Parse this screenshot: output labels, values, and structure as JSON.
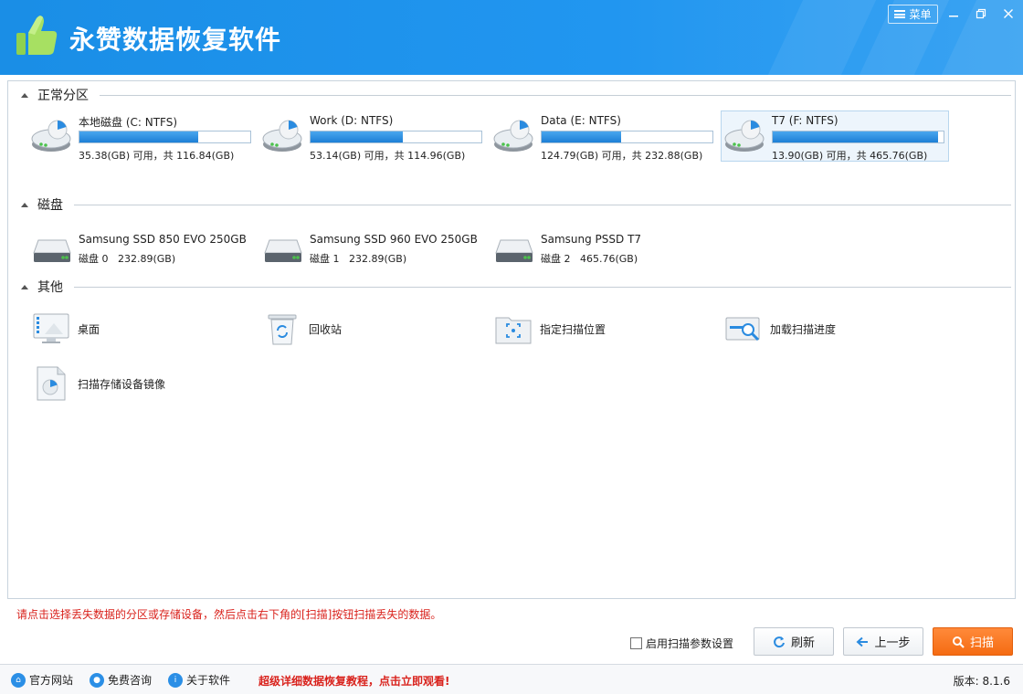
{
  "app": {
    "title": "永赞数据恢复软件",
    "menu_label": "菜单"
  },
  "sections": {
    "partitions": "正常分区",
    "disks": "磁盘",
    "other": "其他"
  },
  "partitions": [
    {
      "name": "本地磁盘 (C: NTFS)",
      "info": "35.38(GB) 可用，共 116.84(GB)",
      "used_fraction": 0.697,
      "selected": false
    },
    {
      "name": "Work (D: NTFS)",
      "info": "53.14(GB) 可用，共 114.96(GB)",
      "used_fraction": 0.538,
      "selected": false
    },
    {
      "name": "Data (E: NTFS)",
      "info": "124.79(GB) 可用，共 232.88(GB)",
      "used_fraction": 0.464,
      "selected": false
    },
    {
      "name": "T7 (F: NTFS)",
      "info": "13.90(GB) 可用，共 465.76(GB)",
      "used_fraction": 0.97,
      "selected": true
    }
  ],
  "disks": [
    {
      "name": "Samsung SSD 850 EVO 250GB",
      "id": "磁盘 0",
      "size": "232.89(GB)"
    },
    {
      "name": "Samsung SSD 960 EVO 250GB",
      "id": "磁盘 1",
      "size": "232.89(GB)"
    },
    {
      "name": "Samsung PSSD T7",
      "id": "磁盘 2",
      "size": "465.76(GB)"
    }
  ],
  "other": [
    {
      "label": "桌面",
      "icon": "desktop-icon"
    },
    {
      "label": "回收站",
      "icon": "recycle-bin-icon"
    },
    {
      "label": "指定扫描位置",
      "icon": "folder-scan-icon"
    },
    {
      "label": "加载扫描进度",
      "icon": "load-progress-icon"
    },
    {
      "label": "扫描存储设备镜像",
      "icon": "disk-image-icon"
    }
  ],
  "hint": "请点击选择丢失数据的分区或存储设备，然后点击右下角的[扫描]按钮扫描丢失的数据。",
  "controls": {
    "param_checkbox": "启用扫描参数设置",
    "refresh": "刷新",
    "back": "上一步",
    "scan": "扫描"
  },
  "statusbar": {
    "website": "官方网站",
    "consult": "免费咨询",
    "about": "关于软件",
    "promo": "超级详细数据恢复教程，点击立即观看!",
    "version": "版本: 8.1.6"
  },
  "colors": {
    "titlebar": "#1a8ee6",
    "bar_fill": "#1c7fd6",
    "scan_button": "#f56b12",
    "hint_text": "#d9221c"
  }
}
